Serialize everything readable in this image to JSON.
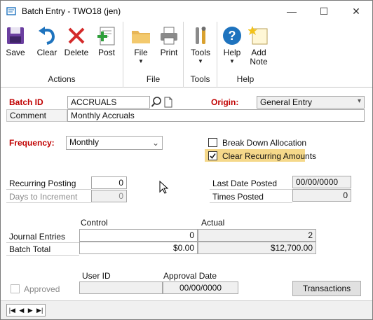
{
  "window": {
    "title": "Batch Entry  -  TWO18 (jen)",
    "controls": {
      "minimize": "—",
      "maximize": "☐",
      "close": "✕"
    }
  },
  "ribbon": {
    "groups": [
      {
        "label": "Actions",
        "buttons": [
          {
            "label": "Save",
            "icon": "save-icon"
          },
          {
            "label": "Clear",
            "icon": "undo-icon"
          },
          {
            "label": "Delete",
            "icon": "delete-icon"
          },
          {
            "label": "Post",
            "icon": "post-icon"
          }
        ]
      },
      {
        "label": "File",
        "buttons": [
          {
            "label": "File",
            "icon": "folder-icon"
          },
          {
            "label": "Print",
            "icon": "printer-icon"
          }
        ]
      },
      {
        "label": "Tools",
        "buttons": [
          {
            "label": "Tools",
            "icon": "tools-icon"
          }
        ]
      },
      {
        "label": "Help",
        "buttons": [
          {
            "label": "Help",
            "icon": "help-icon"
          },
          {
            "label": "Add",
            "label2": "Note",
            "icon": "add-note-icon"
          }
        ]
      }
    ]
  },
  "form": {
    "batch_id_label": "Batch ID",
    "batch_id_value": "ACCRUALS",
    "origin_label": "Origin:",
    "origin_value": "General Entry",
    "comment_label": "Comment",
    "comment_value": "Monthly Accruals",
    "frequency_label": "Frequency:",
    "frequency_value": "Monthly",
    "break_down_label": "Break Down Allocation",
    "break_down_checked": false,
    "clear_recurring_label": "Clear Recurring Amounts",
    "clear_recurring_checked": true,
    "recurring_posting_label": "Recurring Posting",
    "recurring_posting_value": "0",
    "days_to_increment_label": "Days to Increment",
    "days_to_increment_value": "0",
    "last_date_posted_label": "Last Date Posted",
    "last_date_posted_value": "00/00/0000",
    "times_posted_label": "Times Posted",
    "times_posted_value": "0",
    "control_header": "Control",
    "actual_header": "Actual",
    "journal_entries_label": "Journal Entries",
    "journal_entries_control": "0",
    "journal_entries_actual": "2",
    "batch_total_label": "Batch Total",
    "batch_total_control": "$0.00",
    "batch_total_actual": "$12,700.00",
    "user_id_header": "User ID",
    "approval_date_header": "Approval Date",
    "approved_label": "Approved",
    "approved_checked": false,
    "user_id_value": "",
    "approval_date_value": "00/00/0000",
    "transactions_button": "Transactions"
  },
  "statusbar": {
    "nav": [
      "|◀",
      "◀",
      "▶",
      "▶|"
    ]
  },
  "colors": {
    "required_label": "#c00000",
    "highlight": "#f5d88a",
    "accent_blue": "#1e73be"
  }
}
